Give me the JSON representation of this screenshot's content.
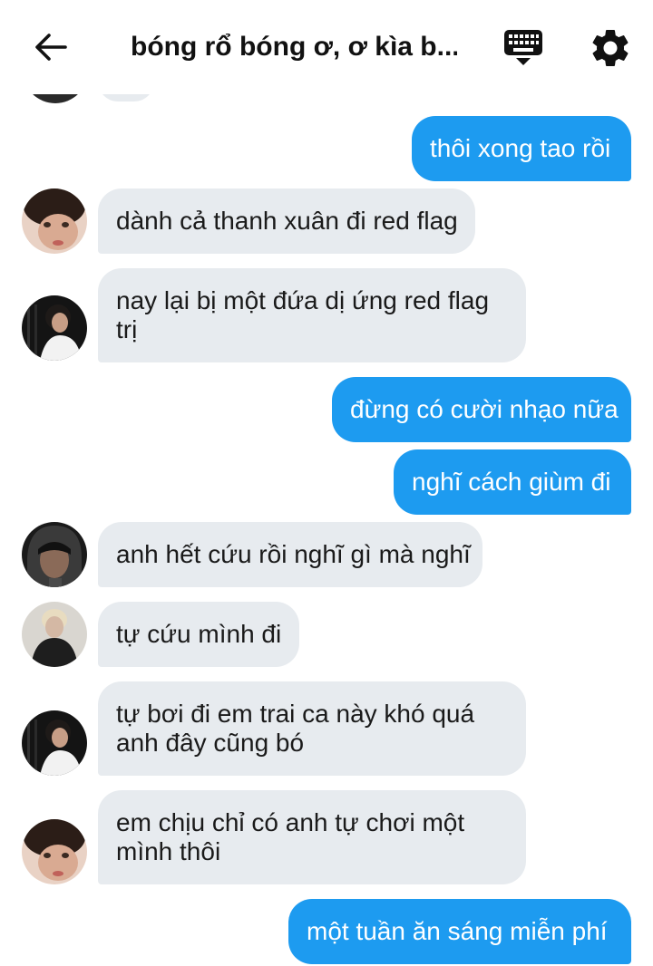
{
  "header": {
    "title": "bóng rổ bóng ơ, ơ kìa b..."
  },
  "messages": [
    {
      "side": "out",
      "text": "thôi xong tao rồi"
    },
    {
      "side": "in",
      "avatar": "avatar-a",
      "lines": [
        "dành cả thanh xuân đi red flag"
      ]
    },
    {
      "side": "in",
      "avatar": "avatar-b",
      "lines": [
        "nay lại bị một đứa dị ứng red flag",
        "trị"
      ]
    },
    {
      "side": "out",
      "text": "đừng có cười nhạo nữa"
    },
    {
      "side": "out",
      "text": "nghĩ cách giùm đi"
    },
    {
      "side": "in",
      "avatar": "avatar-c",
      "lines": [
        "anh hết cứu rồi nghĩ gì mà nghĩ"
      ]
    },
    {
      "side": "in",
      "avatar": "avatar-d",
      "lines": [
        "tự cứu mình đi"
      ]
    },
    {
      "side": "in",
      "avatar": "avatar-b",
      "lines": [
        "tự bơi đi em trai ca này khó quá",
        "anh đây cũng bó"
      ]
    },
    {
      "side": "in",
      "avatar": "avatar-a",
      "lines": [
        "em chịu chỉ có anh tự chơi một",
        "mình thôi"
      ]
    },
    {
      "side": "out",
      "text": "một tuần ăn sáng miễn phí"
    }
  ],
  "icons": {
    "back": "arrow-left-icon",
    "keyboard": "keyboard-icon",
    "settings": "gear-icon"
  },
  "colors": {
    "outgoing_bubble": "#1d9bf0",
    "incoming_bubble": "#e7ebef",
    "background": "#ffffff"
  }
}
